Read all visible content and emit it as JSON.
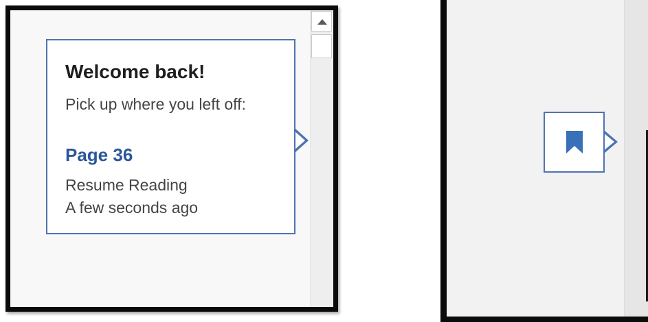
{
  "resume_callout": {
    "title": "Welcome back!",
    "subtitle": "Pick up where you left off:",
    "page_link": "Page 36",
    "action_label": "Resume Reading",
    "timestamp": "A few seconds ago"
  },
  "bookmark_marker": {
    "icon": "bookmark-icon"
  },
  "colors": {
    "accent": "#2b579a",
    "callout_border": "#4f73b0",
    "frame": "#0b0b0b",
    "scroll_arrow": "#5b5b5b",
    "bookmark_icon": "#3a70b8"
  }
}
